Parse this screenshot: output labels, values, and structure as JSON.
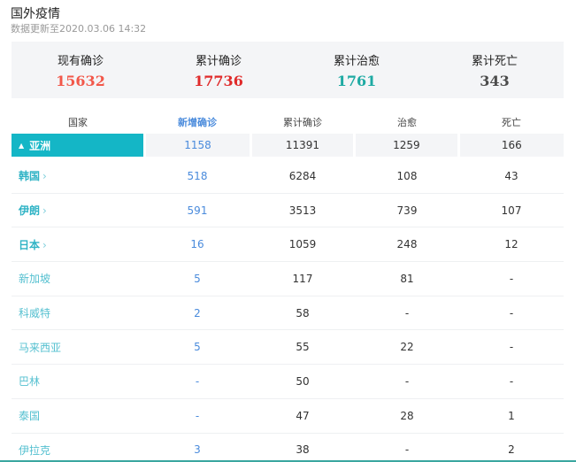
{
  "header": {
    "title": "国外疫情",
    "update_time": "数据更新至2020.03.06 14:32"
  },
  "summary": [
    {
      "label": "现有确诊",
      "value": "15632",
      "color": "#f2584a"
    },
    {
      "label": "累计确诊",
      "value": "17736",
      "color": "#e02a2a"
    },
    {
      "label": "累计治愈",
      "value": "1761",
      "color": "#1eaaa3"
    },
    {
      "label": "累计死亡",
      "value": "343",
      "color": "#4c4c4c"
    }
  ],
  "table": {
    "headers": {
      "country": "国家",
      "new": "新增确诊",
      "total": "累计确诊",
      "cured": "治愈",
      "dead": "死亡"
    },
    "region": {
      "name": "亚洲",
      "new": "1158",
      "total": "11391",
      "cured": "1259",
      "dead": "166"
    },
    "rows": [
      {
        "country": "韩国",
        "new": "518",
        "total": "6284",
        "cured": "108",
        "dead": "43",
        "expandable": true
      },
      {
        "country": "伊朗",
        "new": "591",
        "total": "3513",
        "cured": "739",
        "dead": "107",
        "expandable": true
      },
      {
        "country": "日本",
        "new": "16",
        "total": "1059",
        "cured": "248",
        "dead": "12",
        "expandable": true
      },
      {
        "country": "新加坡",
        "new": "5",
        "total": "117",
        "cured": "81",
        "dead": "-",
        "expandable": false
      },
      {
        "country": "科威特",
        "new": "2",
        "total": "58",
        "cured": "-",
        "dead": "-",
        "expandable": false
      },
      {
        "country": "马来西亚",
        "new": "5",
        "total": "55",
        "cured": "22",
        "dead": "-",
        "expandable": false
      },
      {
        "country": "巴林",
        "new": "-",
        "total": "50",
        "cured": "-",
        "dead": "-",
        "expandable": false
      },
      {
        "country": "泰国",
        "new": "-",
        "total": "47",
        "cured": "28",
        "dead": "1",
        "expandable": false
      },
      {
        "country": "伊拉克",
        "new": "3",
        "total": "38",
        "cured": "-",
        "dead": "2",
        "expandable": false
      }
    ]
  },
  "icons": {
    "region_toggle": "triangle-up-icon",
    "row_expand": "chevron-right-icon"
  }
}
